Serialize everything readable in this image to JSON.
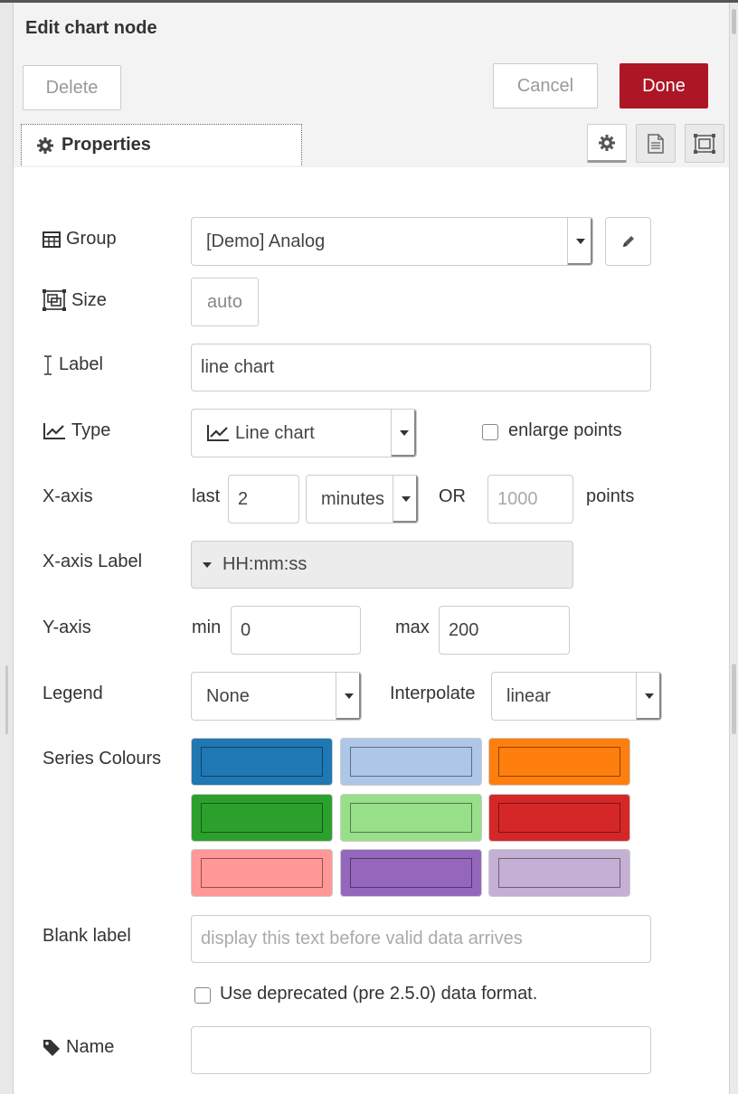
{
  "tray": {
    "title": "Edit chart node",
    "delete_label": "Delete",
    "cancel_label": "Cancel",
    "done_label": "Done"
  },
  "tabs": {
    "properties_label": "Properties"
  },
  "form": {
    "group_label": "Group",
    "group_value": "[Demo] Analog",
    "size_label": "Size",
    "size_value": "auto",
    "label_label": "Label",
    "label_value": "line chart",
    "type_label": "Type",
    "type_value": "Line chart",
    "enlarge_points_label": "enlarge points",
    "xaxis_label": "X-axis",
    "xaxis_last": "last",
    "xaxis_value": "2",
    "xaxis_unit": "minutes",
    "xaxis_or": "OR",
    "xaxis_points_placeholder": "1000",
    "xaxis_points_label": "points",
    "xaxis_label_label": "X-axis Label",
    "xaxis_label_value": "HH:mm:ss",
    "yaxis_label": "Y-axis",
    "yaxis_min_label": "min",
    "yaxis_min_value": "0",
    "yaxis_max_label": "max",
    "yaxis_max_value": "200",
    "legend_label": "Legend",
    "legend_value": "None",
    "interpolate_label": "Interpolate",
    "interpolate_value": "linear",
    "series_colours_label": "Series Colours",
    "series_colours": [
      "#1f77b4",
      "#aec7e8",
      "#ff7f0e",
      "#2ca02c",
      "#98df8a",
      "#d62728",
      "#ff9896",
      "#9467bd",
      "#c5b0d5"
    ],
    "blank_label_label": "Blank label",
    "blank_label_placeholder": "display this text before valid data arrives",
    "deprecated_label": "Use deprecated (pre 2.5.0) data format.",
    "name_label": "Name",
    "name_value": ""
  }
}
